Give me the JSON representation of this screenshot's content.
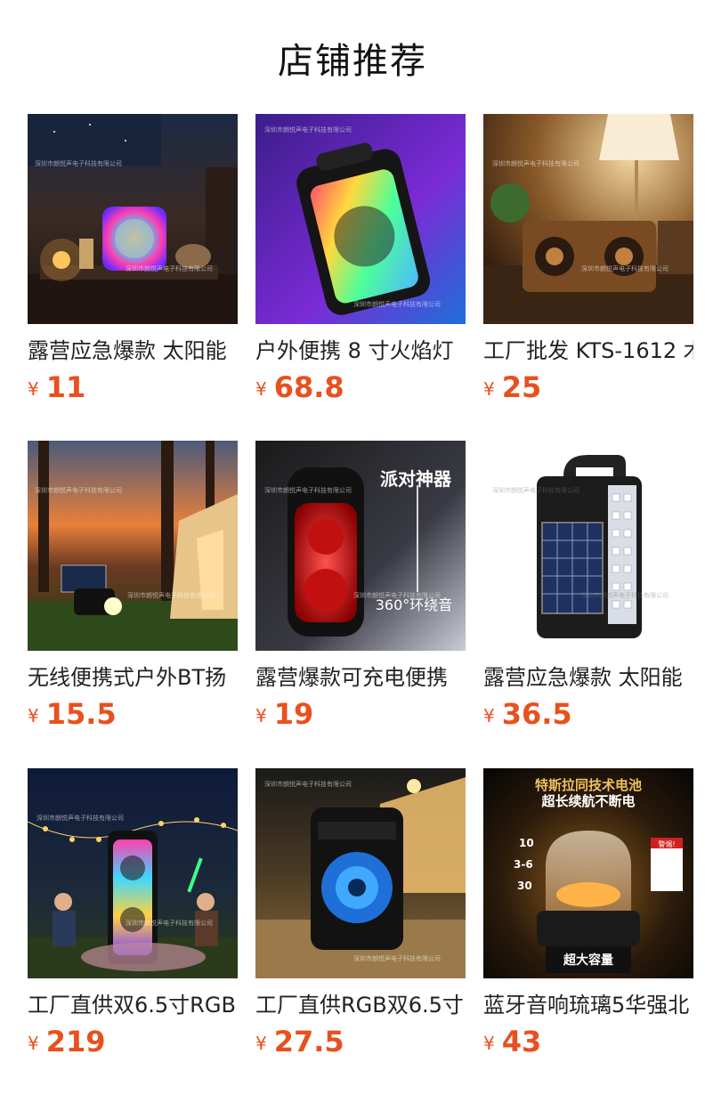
{
  "section_title": "店铺推荐",
  "watermark": "深圳市朗悦声电子科技有限公司",
  "currency": "¥",
  "products": [
    {
      "name": "露营应急爆款 太阳能",
      "price": "11"
    },
    {
      "name": "户外便携 8 寸火焰灯",
      "price": "68.8"
    },
    {
      "name": "工厂批发 KTS-1612 木",
      "price": "25"
    },
    {
      "name": "无线便携式户外BT扬",
      "price": "15.5"
    },
    {
      "name": "露营爆款可充电便携",
      "price": "19",
      "image_text": [
        "派对神器",
        "360°环绕音"
      ]
    },
    {
      "name": "露营应急爆款 太阳能",
      "price": "36.5"
    },
    {
      "name": "工厂直供双6.5寸RGB",
      "price": "219"
    },
    {
      "name": "工厂直供RGB双6.5寸",
      "price": "27.5"
    },
    {
      "name": "蓝牙音响琉璃5华强北",
      "price": "43",
      "image_text": [
        "特斯拉同技术电池",
        "超长续航不断电",
        "超大容量",
        "10",
        "3-6",
        "30",
        "警惕!"
      ]
    }
  ],
  "colors": {
    "price": "#e8501e",
    "title": "#111111"
  }
}
